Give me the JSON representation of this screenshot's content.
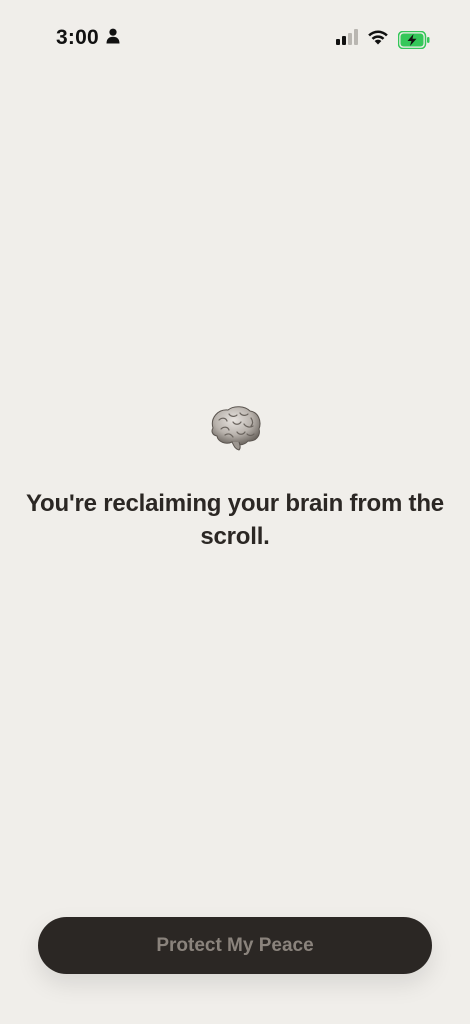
{
  "status_bar": {
    "time": "3:00",
    "person_icon": "person-icon",
    "signal_icon": "cellular-signal-icon",
    "wifi_icon": "wifi-icon",
    "battery_icon": "battery-charging-icon",
    "battery_color": "#34c759"
  },
  "main": {
    "emoji_icon": "brain-icon",
    "headline": "You're reclaiming your brain from the scroll."
  },
  "cta": {
    "label": "Protect My Peace"
  },
  "colors": {
    "background": "#f0eeea",
    "button_bg": "#2b2724",
    "button_text": "#8a837c",
    "text": "#2b2724"
  }
}
